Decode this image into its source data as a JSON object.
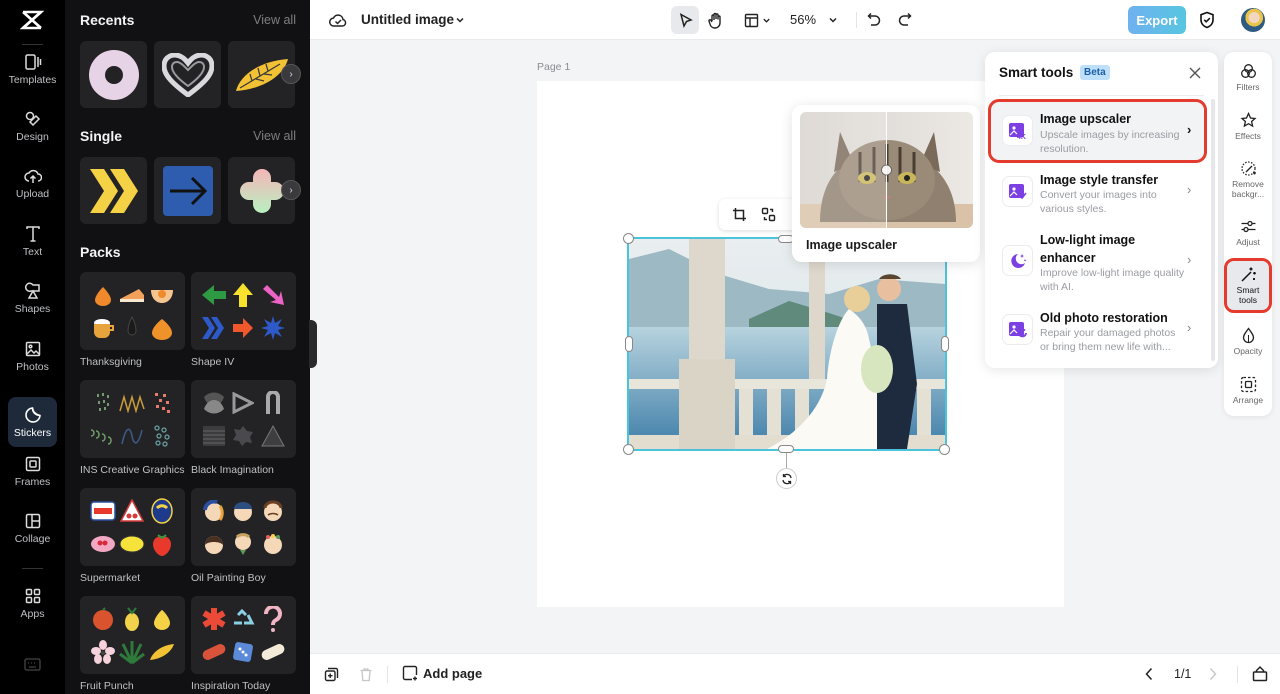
{
  "rail": {
    "items": [
      {
        "label": "Templates",
        "icon": "templates-icon"
      },
      {
        "label": "Design",
        "icon": "design-icon"
      },
      {
        "label": "Upload",
        "icon": "upload-icon"
      },
      {
        "label": "Text",
        "icon": "text-icon"
      },
      {
        "label": "Shapes",
        "icon": "shapes-icon"
      },
      {
        "label": "Photos",
        "icon": "photos-icon"
      },
      {
        "label": "Stickers",
        "icon": "stickers-icon",
        "active": true
      },
      {
        "label": "Frames",
        "icon": "frames-icon"
      },
      {
        "label": "Collage",
        "icon": "collage-icon"
      },
      {
        "label": "Apps",
        "icon": "apps-icon"
      }
    ]
  },
  "panel": {
    "recents": {
      "title": "Recents",
      "view_all": "View all"
    },
    "single": {
      "title": "Single",
      "view_all": "View all"
    },
    "packs": {
      "title": "Packs",
      "items": [
        {
          "label": "Thanksgiving"
        },
        {
          "label": "Shape IV"
        },
        {
          "label": "INS Creative Graphics"
        },
        {
          "label": "Black Imagination"
        },
        {
          "label": "Supermarket"
        },
        {
          "label": "Oil Painting Boy"
        },
        {
          "label": "Fruit Punch"
        },
        {
          "label": "Inspiration Today"
        }
      ]
    }
  },
  "topbar": {
    "doc_title": "Untitled image",
    "zoom": "56%",
    "export_label": "Export"
  },
  "canvas": {
    "page_label": "Page 1"
  },
  "preview": {
    "caption": "Image upscaler"
  },
  "smart_tools": {
    "title": "Smart tools",
    "badge": "Beta",
    "tools": [
      {
        "title": "Image upscaler",
        "desc": "Upscale images by increasing resolution.",
        "selected": true
      },
      {
        "title": "Image style transfer",
        "desc": "Convert your images into various styles."
      },
      {
        "title": "Low-light image enhancer",
        "desc": "Improve low-light image quality with AI."
      },
      {
        "title": "Old photo restoration",
        "desc": "Repair your damaged photos or bring them new life with..."
      }
    ]
  },
  "right_tools": {
    "items": [
      {
        "label": "Filters"
      },
      {
        "label": "Effects"
      },
      {
        "label": "Remove backgr..."
      },
      {
        "label": "Adjust"
      },
      {
        "label": "Smart tools",
        "selected": true
      },
      {
        "label": "Opacity"
      },
      {
        "label": "Arrange"
      }
    ]
  },
  "bottombar": {
    "add_page": "Add page",
    "page_count": "1/1"
  },
  "colors": {
    "accent": "#4cc3dc",
    "highlight": "#e33b2d",
    "tool_icon": "#7b3fe4"
  }
}
